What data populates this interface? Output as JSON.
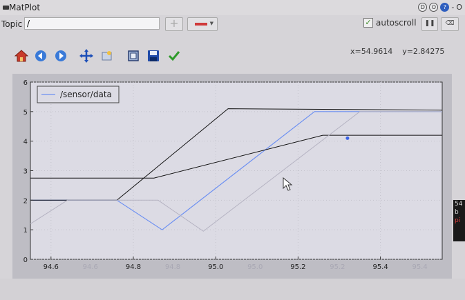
{
  "window": {
    "title": "MatPlot",
    "controls": [
      "D",
      "O",
      "?",
      "-",
      "O"
    ]
  },
  "topic_bar": {
    "label": "Topic",
    "value": "/",
    "add_icon": "plus-icon",
    "color_button": {
      "color": "#d03a3a"
    },
    "autoscroll_label": "autoscroll",
    "autoscroll_checked": true,
    "pause_icon": "pause-icon",
    "clear_icon": "clear-icon"
  },
  "toolbar": {
    "tools": [
      {
        "name": "home-icon"
      },
      {
        "name": "back-icon"
      },
      {
        "name": "forward-icon"
      },
      {
        "name": "pan-icon"
      },
      {
        "name": "zoom-icon"
      },
      {
        "name": "subplots-icon"
      },
      {
        "name": "save-icon"
      },
      {
        "name": "apply-icon"
      }
    ],
    "coords_text": "x=54.9614    y=2.84275"
  },
  "chart_data": {
    "type": "line",
    "xlim": [
      94.55,
      95.55
    ],
    "ylim": [
      0,
      6
    ],
    "x_ticks": [
      "94.6",
      "94.8",
      "95.0",
      "95.2",
      "95.4"
    ],
    "y_ticks": [
      "0",
      "1",
      "2",
      "3",
      "4",
      "5",
      "6"
    ],
    "ghost_x_ticks": [
      "94.6",
      "94.8",
      "95.0",
      "95.2",
      "95.4"
    ],
    "grid": true,
    "legend": {
      "position": "top-left"
    },
    "series": [
      {
        "name": "/sensor/data",
        "color": "#6b8ff2",
        "x": [
          94.55,
          94.76,
          94.87,
          95.24,
          95.55
        ],
        "y": [
          2.0,
          2.0,
          1.0,
          5.0,
          5.0
        ]
      },
      {
        "color": "#111111",
        "x": [
          94.55,
          94.76,
          95.03,
          95.55
        ],
        "y": [
          2.0,
          2.0,
          5.1,
          5.05
        ]
      },
      {
        "color": "#111111",
        "x": [
          94.55,
          94.85,
          95.26,
          95.55
        ],
        "y": [
          2.75,
          2.75,
          4.2,
          4.2
        ]
      },
      {
        "color": "#b5b3c2",
        "x": [
          94.55,
          94.64,
          94.86,
          94.97,
          95.35,
          95.55
        ],
        "y": [
          1.2,
          2.0,
          2.0,
          0.95,
          5.0,
          5.0
        ]
      }
    ],
    "marker": {
      "x": 95.32,
      "y": 4.1,
      "color": "#3b63e6"
    }
  }
}
